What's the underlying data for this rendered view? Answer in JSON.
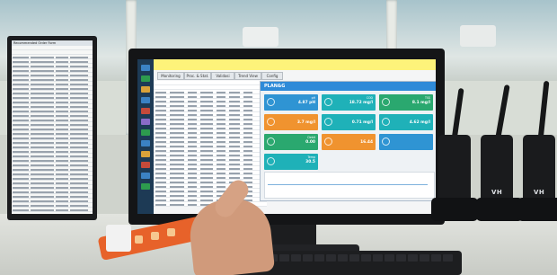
{
  "left_monitor": {
    "title": "Recommended Order Form",
    "row_count": 44
  },
  "main_screen": {
    "app_title": "",
    "tabs": [
      "Monitoring",
      "Proc. & Stat.",
      "Validasi",
      "Trend View",
      "Config"
    ],
    "grid_rows": 34
  },
  "dashboard": {
    "title": "PLAN&G",
    "subtitle": "",
    "tiles": [
      {
        "label": "pH",
        "value": "4.87 pH",
        "color": "#2f94d3"
      },
      {
        "label": "COD",
        "value": "18.72 mg/l",
        "color": "#1fb1b8"
      },
      {
        "label": "TSS",
        "value": "8.1 mg/l",
        "color": "#2aa86f"
      },
      {
        "label": "",
        "value": "3.7 mg/l",
        "color": "#f0932f"
      },
      {
        "label": "",
        "value": "0.71 mg/l",
        "color": "#1fb1b8"
      },
      {
        "label": "",
        "value": "4.62 mg/l",
        "color": "#1fb1b8"
      },
      {
        "label": "Debit",
        "value": "0.00",
        "color": "#2aa86f"
      },
      {
        "label": "",
        "value": "16.44",
        "color": "#f0932f"
      },
      {
        "label": "",
        "value": "",
        "color": "#2f94d3"
      },
      {
        "label": "Temp",
        "value": "30.5",
        "color": "#1fb1b8"
      }
    ]
  },
  "radios": [
    {
      "brand": ""
    },
    {
      "brand": "VH"
    },
    {
      "brand": "VH"
    }
  ],
  "colors": {
    "power_strip": "#e7622a",
    "app_titlebar": "#fdf37a",
    "dashboard_header": "#2e8ad8"
  }
}
